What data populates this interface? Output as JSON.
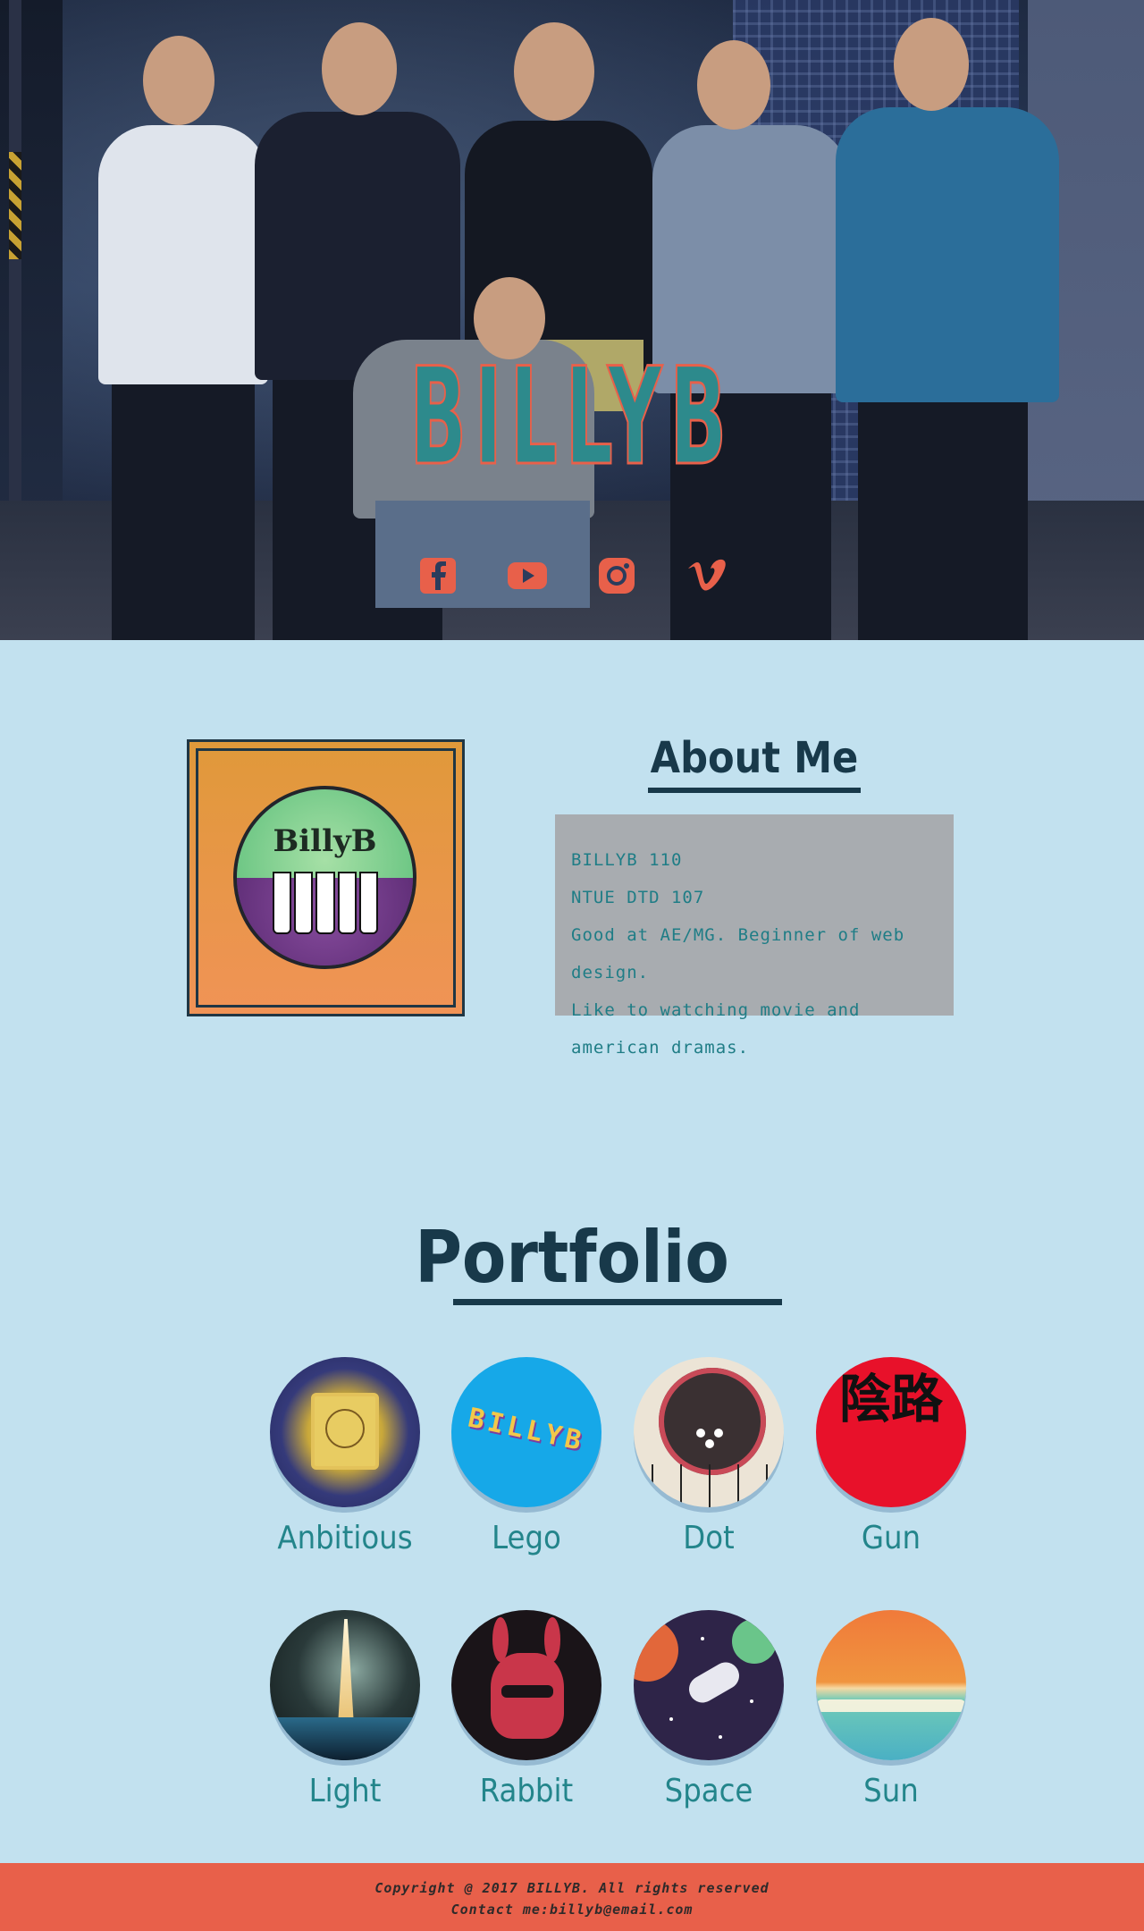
{
  "hero": {
    "brand": "BILLYB",
    "socials": [
      {
        "icon": "facebook-icon"
      },
      {
        "icon": "youtube-icon"
      },
      {
        "icon": "instagram-icon"
      },
      {
        "icon": "vimeo-icon"
      }
    ],
    "social_color": "#e8604a"
  },
  "about": {
    "logo_text": "BillyB",
    "title": "About Me",
    "lines": [
      "BILLYB 110",
      "NTUE DTD 107",
      "Good at AE/MG. Beginner of web design.",
      "Like to watching movie and american dramas."
    ]
  },
  "portfolio": {
    "title": "Portfolio",
    "lego_thumb_text": "BILLYB",
    "gun_thumb_text": "陰路",
    "items": [
      {
        "label": "Anbitious"
      },
      {
        "label": "Lego"
      },
      {
        "label": "Dot"
      },
      {
        "label": "Gun"
      },
      {
        "label": "Light"
      },
      {
        "label": "Rabbit"
      },
      {
        "label": "Space"
      },
      {
        "label": "Sun"
      }
    ]
  },
  "footer": {
    "copyright": "Copyright @ 2017 BILLYB. All rights reserved",
    "contact": "Contact me:billyb@email.com"
  },
  "colors": {
    "background": "#c2e1ef",
    "dark": "#18394a",
    "accent": "#e8604a",
    "teal": "#23858b"
  }
}
